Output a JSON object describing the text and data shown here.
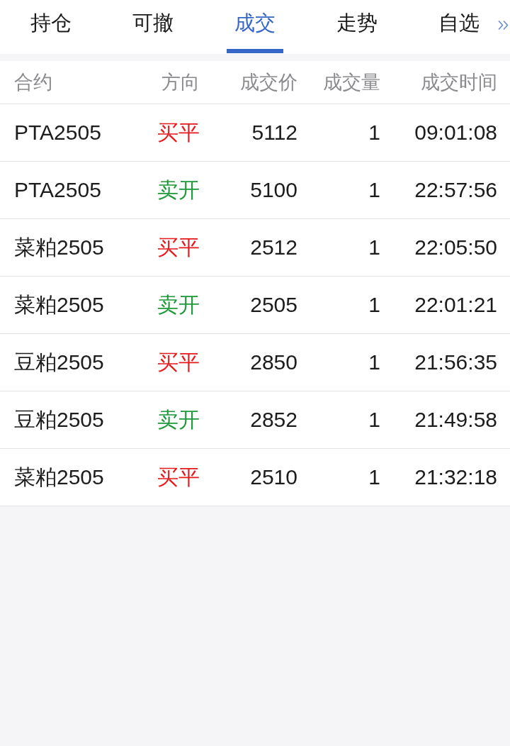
{
  "tabs": [
    {
      "label": "持仓",
      "selected": false
    },
    {
      "label": "可撤",
      "selected": false
    },
    {
      "label": "成交",
      "selected": true
    },
    {
      "label": "走势",
      "selected": false
    },
    {
      "label": "自选",
      "selected": false
    }
  ],
  "table": {
    "columns": [
      "合约",
      "方向",
      "成交价",
      "成交量",
      "成交时间"
    ],
    "rows": [
      {
        "contract": "PTA2505",
        "direction": "买平",
        "color": "#e8191b",
        "price": "5112",
        "volume": "1",
        "time": "09:01:08"
      },
      {
        "contract": "PTA2505",
        "direction": "卖开",
        "color": "#1f9a3a",
        "price": "5100",
        "volume": "1",
        "time": "22:57:56"
      },
      {
        "contract": "菜粕2505",
        "direction": "买平",
        "color": "#e8191b",
        "price": "2512",
        "volume": "1",
        "time": "22:05:50"
      },
      {
        "contract": "菜粕2505",
        "direction": "卖开",
        "color": "#1f9a3a",
        "price": "2505",
        "volume": "1",
        "time": "22:01:21"
      },
      {
        "contract": "豆粕2505",
        "direction": "买平",
        "color": "#e8191b",
        "price": "2850",
        "volume": "1",
        "time": "21:56:35"
      },
      {
        "contract": "豆粕2505",
        "direction": "卖开",
        "color": "#1f9a3a",
        "price": "2852",
        "volume": "1",
        "time": "21:49:58"
      },
      {
        "contract": "菜粕2505",
        "direction": "买平",
        "color": "#e8191b",
        "price": "2510",
        "volume": "1",
        "time": "21:32:18"
      }
    ]
  }
}
